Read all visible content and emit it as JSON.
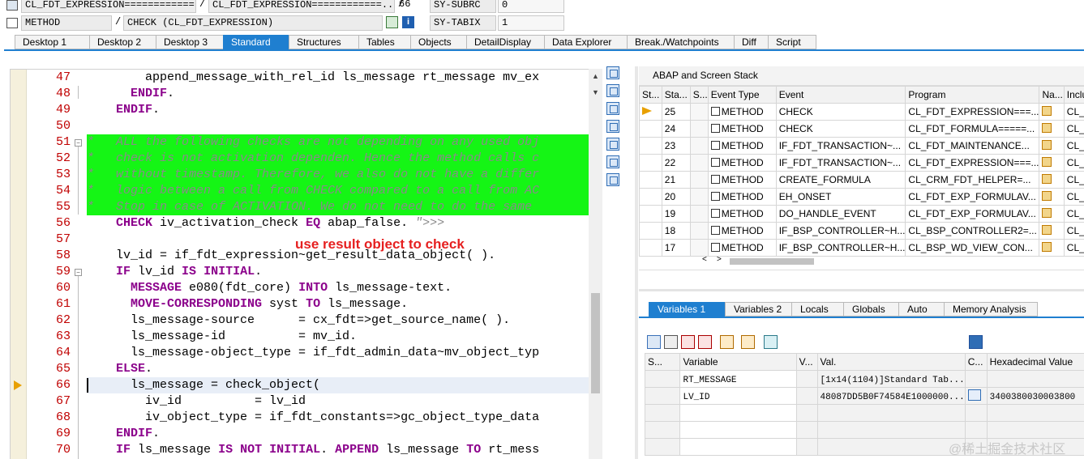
{
  "top_fields": {
    "class_name": "CL_FDT_EXPRESSION============...",
    "class_name2": "CL_FDT_EXPRESSION============...",
    "line_sep": "/",
    "line_number": "66",
    "subrc_label": "SY-SUBRC",
    "subrc_value": "0",
    "kind": "METHOD",
    "method_sep": "/",
    "method_name": "CHECK (CL_FDT_EXPRESSION)",
    "tabix_label": "SY-TABIX",
    "tabix_value": "1"
  },
  "main_tabs": [
    "Desktop 1",
    "Desktop 2",
    "Desktop 3",
    "Standard",
    "Structures",
    "Tables",
    "Objects",
    "DetailDisplay",
    "Data Explorer",
    "Break./Watchpoints",
    "Diff",
    "Script"
  ],
  "active_main_tab": "Standard",
  "code_lines": [
    {
      "n": "47",
      "t": "        append_message_with_rel_id ls_message rt_message mv_ex"
    },
    {
      "n": "48",
      "t": "      ENDIF."
    },
    {
      "n": "49",
      "t": "    ENDIF."
    },
    {
      "n": "50",
      "t": ""
    },
    {
      "n": "51",
      "t": "*   ALL the following checks are not depending on any used obj"
    },
    {
      "n": "52",
      "t": "*   check is not activation dependen. Hence the method calls c"
    },
    {
      "n": "53",
      "t": "*   without timestamp. Therefore, we also do not have a differ"
    },
    {
      "n": "54",
      "t": "*   logic between a call from CHECK compared to a call from AC"
    },
    {
      "n": "55",
      "t": "*   Stop in case of ACTIVATION. We do not need to do the same"
    },
    {
      "n": "56",
      "t": "    CHECK iv_activation_check EQ abap_false. \">>>"
    },
    {
      "n": "57",
      "t": ""
    },
    {
      "n": "58",
      "t": "    lv_id = if_fdt_expression~get_result_data_object( )."
    },
    {
      "n": "59",
      "t": "    IF lv_id IS INITIAL."
    },
    {
      "n": "60",
      "t": "      MESSAGE e080(fdt_core) INTO ls_message-text."
    },
    {
      "n": "61",
      "t": "      MOVE-CORRESPONDING syst TO ls_message."
    },
    {
      "n": "62",
      "t": "      ls_message-source      = cx_fdt=>get_source_name( )."
    },
    {
      "n": "63",
      "t": "      ls_message-id          = mv_id."
    },
    {
      "n": "64",
      "t": "      ls_message-object_type = if_fdt_admin_data~mv_object_typ"
    },
    {
      "n": "65",
      "t": "    ELSE."
    },
    {
      "n": "66",
      "t": "      ls_message = check_object("
    },
    {
      "n": "67",
      "t": "        iv_id          = lv_id"
    },
    {
      "n": "68",
      "t": "        iv_object_type = if_fdt_constants=>gc_object_type_data"
    },
    {
      "n": "69",
      "t": "    ENDIF."
    },
    {
      "n": "70",
      "t": "    IF ls_message IS NOT INITIAL. APPEND ls_message TO rt_mess"
    }
  ],
  "annotation": "use result object to check",
  "stack": {
    "title": "ABAP and Screen Stack",
    "headers": [
      "St...",
      "Sta...",
      "S...",
      "Event Type",
      "Event",
      "Program",
      "Na...",
      "Inclu"
    ],
    "rows": [
      {
        "level": "25",
        "type": "METHOD",
        "event": "CHECK",
        "program": "CL_FDT_EXPRESSION===...",
        "incl": "CL_F"
      },
      {
        "level": "24",
        "type": "METHOD",
        "event": "CHECK",
        "program": "CL_FDT_FORMULA=====...",
        "incl": "CL_F"
      },
      {
        "level": "23",
        "type": "METHOD",
        "event": "IF_FDT_TRANSACTION~...",
        "program": "CL_FDT_MAINTENANCE...",
        "incl": "CL_F"
      },
      {
        "level": "22",
        "type": "METHOD",
        "event": "IF_FDT_TRANSACTION~...",
        "program": "CL_FDT_EXPRESSION===...",
        "incl": "CL_F"
      },
      {
        "level": "21",
        "type": "METHOD",
        "event": "CREATE_FORMULA",
        "program": "CL_CRM_FDT_HELPER=...",
        "incl": "CL_C"
      },
      {
        "level": "20",
        "type": "METHOD",
        "event": "EH_ONSET",
        "program": "CL_FDT_EXP_FORMULAV...",
        "incl": "CL_F"
      },
      {
        "level": "19",
        "type": "METHOD",
        "event": "DO_HANDLE_EVENT",
        "program": "CL_FDT_EXP_FORMULAV...",
        "incl": "CL_F"
      },
      {
        "level": "18",
        "type": "METHOD",
        "event": "IF_BSP_CONTROLLER~H...",
        "program": "CL_BSP_CONTROLLER2=...",
        "incl": "CL_B"
      },
      {
        "level": "17",
        "type": "METHOD",
        "event": "IF_BSP_CONTROLLER~H...",
        "program": "CL_BSP_WD_VIEW_CON...",
        "incl": "CL_B"
      }
    ]
  },
  "var_tabs": [
    "Variables 1",
    "Variables 2",
    "Locals",
    "Globals",
    "Auto",
    "Memory Analysis"
  ],
  "active_var_tab": "Variables 1",
  "variables": {
    "headers": [
      "S...",
      "Variable",
      "V...",
      "Val.",
      "C...",
      "Hexadecimal Value"
    ],
    "rows": [
      {
        "name": "RT_MESSAGE",
        "value": "[1x14(1104)]Standard Tab...",
        "hex": ""
      },
      {
        "name": "LV_ID",
        "value": "48087DD5B0F74584E1000000...",
        "hex": "3400380030003800"
      }
    ]
  },
  "watermark": "@稀土掘金技术社区"
}
